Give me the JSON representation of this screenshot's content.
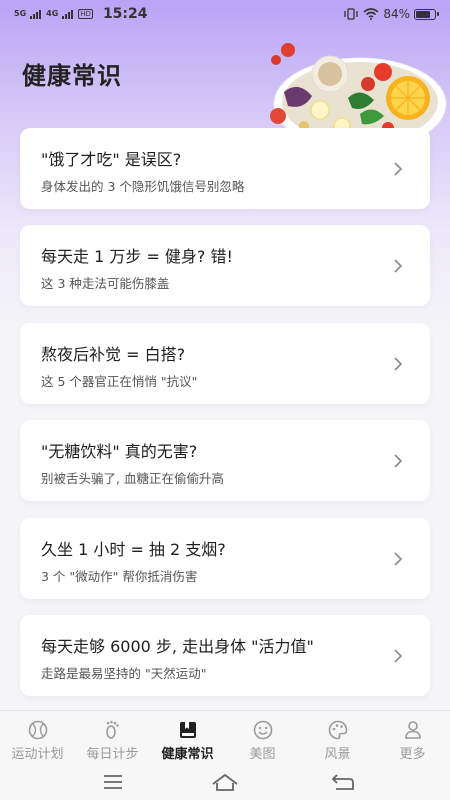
{
  "status_bar": {
    "signal1": "5G",
    "signal2": "4G",
    "hd": "HD",
    "time": "15:24",
    "battery": "84%",
    "battery_level": 0.84
  },
  "page": {
    "title": "健康常识"
  },
  "cards": [
    {
      "title": "\"饿了才吃\" 是误区?",
      "subtitle": "身体发出的 3 个隐形饥饿信号别忽略"
    },
    {
      "title": "每天走 1 万步 = 健身? 错!",
      "subtitle": "这 3 种走法可能伤膝盖"
    },
    {
      "title": "熬夜后补觉 = 白搭?",
      "subtitle": "这 5 个器官正在悄悄 \"抗议\""
    },
    {
      "title": "\"无糖饮料\" 真的无害?",
      "subtitle": "别被舌头骗了, 血糖正在偷偷升高"
    },
    {
      "title": "久坐 1 小时 = 抽 2 支烟?",
      "subtitle": "3 个 \"微动作\" 帮你抵消伤害"
    },
    {
      "title": "每天走够 6000 步, 走出身体 \"活力值\"",
      "subtitle": "走路是最易坚持的 \"天然运动\""
    }
  ],
  "tabs": [
    {
      "label": "运动计划",
      "icon": "sport-ball-icon",
      "active": false
    },
    {
      "label": "每日计步",
      "icon": "footprint-icon",
      "active": false
    },
    {
      "label": "健康常识",
      "icon": "book-icon",
      "active": true
    },
    {
      "label": "美图",
      "icon": "smiley-icon",
      "active": false
    },
    {
      "label": "风景",
      "icon": "palette-icon",
      "active": false
    },
    {
      "label": "更多",
      "icon": "person-icon",
      "active": false
    }
  ],
  "colors": {
    "accent": "#b9a3f5",
    "card_bg": "#ffffff",
    "active_tab": "#222222",
    "inactive_tab": "#9a9a9a"
  }
}
